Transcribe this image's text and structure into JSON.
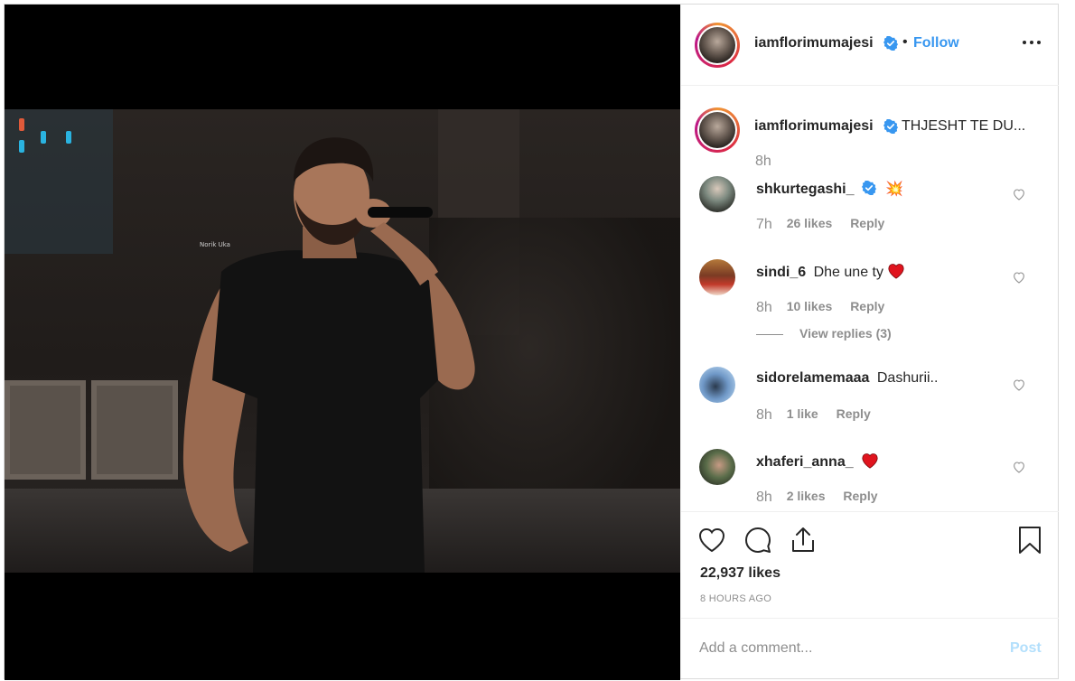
{
  "post": {
    "watermark": "Norik Uka",
    "header": {
      "username": "iamflorimumajesi",
      "separator": "•",
      "follow_label": "Follow",
      "more_icon": "more-options-icon"
    },
    "caption": {
      "username": "iamflorimumajesi",
      "text": "THJESHT TE DU...",
      "time": "8h"
    },
    "comments": [
      {
        "username": "shkurtegashi_",
        "text": "💥",
        "time": "7h",
        "likes": "26 likes",
        "reply": "Reply",
        "verified": true
      },
      {
        "username": "sindi_6",
        "text": "Dhe une ty",
        "time": "8h",
        "likes": "10 likes",
        "reply": "Reply",
        "view_replies": "View replies (3)"
      },
      {
        "username": "sidorelamemaaa",
        "text": "Dashurii..",
        "time": "8h",
        "likes": "1 like",
        "reply": "Reply"
      },
      {
        "username": "xhaferi_anna_",
        "text": "",
        "time": "8h",
        "likes": "2 likes",
        "reply": "Reply"
      }
    ],
    "actions": {
      "likes_count": "22,937 likes",
      "timestamp": "8 HOURS AGO"
    },
    "add_comment": {
      "placeholder": "Add a comment...",
      "post_label": "Post"
    },
    "colors": {
      "link_blue": "#3897f0",
      "post_disabled": "#b2dffc",
      "secondary_text": "#8e8e8e",
      "heart_red": "#ed1c24"
    }
  }
}
